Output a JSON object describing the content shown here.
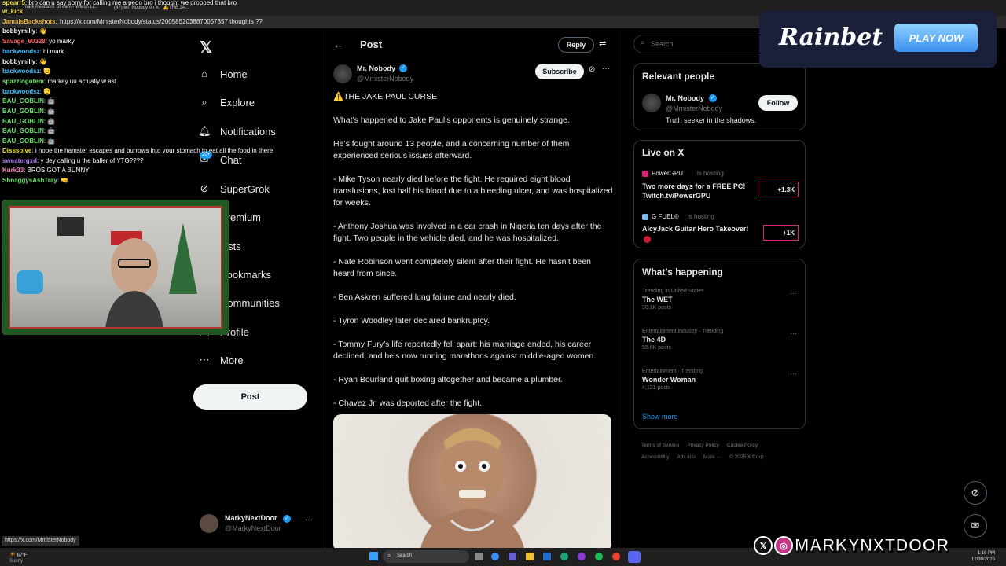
{
  "browser": {
    "tabs": [
      "markynextdoor Stream - Watch Li...",
      "(47) Mr. Nobody on X: \"⚠️THE JA...\""
    ],
    "url": "https://x.com/MmisterNobody/status/2005852038870057357 thoughts ??",
    "status_url": "https://x.com/MmisterNobody"
  },
  "chat": {
    "lines": [
      {
        "user": "spearr5",
        "color": "#f0e040",
        "msg": "bro can u say sorry for calling me a pedo bro i thought we dropped that bro"
      },
      {
        "user": "w_kick",
        "color": "#f0e040",
        "msg": ""
      },
      {
        "user": "JamalsBackshots",
        "color": "#f0c040",
        "msg": ""
      },
      {
        "user": "bobbymilly",
        "color": "#ffffff",
        "msg": "👋"
      },
      {
        "user": "Savage_60328",
        "color": "#ff6060",
        "msg": "yo marky"
      },
      {
        "user": "backwoodsz",
        "color": "#40c0ff",
        "msg": "hi mark"
      },
      {
        "user": "bobbymilly",
        "color": "#ffffff",
        "msg": "👋"
      },
      {
        "user": "backwoodsz",
        "color": "#40c0ff",
        "msg": "🫡"
      },
      {
        "user": "spazzlogotem",
        "color": "#70e070",
        "msg": "markey uu actually w asf"
      },
      {
        "user": "backwoodsz",
        "color": "#40c0ff",
        "msg": "🫡"
      },
      {
        "user": "BAU_GOBLIN",
        "color": "#70e070",
        "msg": "🤖"
      },
      {
        "user": "BAU_GOBLIN",
        "color": "#70e070",
        "msg": "🤖"
      },
      {
        "user": "BAU_GOBLIN",
        "color": "#70e070",
        "msg": "🤖"
      },
      {
        "user": "BAU_GOBLIN",
        "color": "#70e070",
        "msg": "🤖"
      },
      {
        "user": "BAU_GOBLIN",
        "color": "#70e070",
        "msg": "🤖"
      },
      {
        "user": "Disssolve",
        "color": "#f0e040",
        "msg": "i hope the hamster escapes and burrows into your stomach to eat all the food in there"
      },
      {
        "user": "sweatergxd",
        "color": "#b080ff",
        "msg": "y dey calling u the baller of YTG????"
      },
      {
        "user": "Kurk33",
        "color": "#ff80c0",
        "msg": "BROS GOT A BUNNY"
      },
      {
        "user": "ShnaggysAshTray",
        "color": "#70e070",
        "msg": "🤜"
      }
    ]
  },
  "nav": {
    "items": [
      {
        "label": "Home",
        "icon": "home-icon"
      },
      {
        "label": "Explore",
        "icon": "search-icon"
      },
      {
        "label": "Notifications",
        "icon": "bell-icon"
      },
      {
        "label": "Chat",
        "icon": "chat-icon"
      },
      {
        "label": "SuperGrok",
        "icon": "grok-icon"
      },
      {
        "label": "Premium",
        "icon": "x-icon"
      },
      {
        "label": "Lists",
        "icon": "list-icon"
      },
      {
        "label": "Bookmarks",
        "icon": "bookmark-icon"
      },
      {
        "label": "Communities",
        "icon": "people-icon"
      },
      {
        "label": "Profile",
        "icon": "person-icon"
      },
      {
        "label": "More",
        "icon": "more-icon"
      }
    ],
    "post_label": "Post",
    "account": {
      "name": "MarkyNextDoor",
      "handle": "@MarkyNextDoor"
    }
  },
  "post": {
    "header_title": "Post",
    "reply_label": "Reply",
    "author_name": "Mr. Nobody",
    "author_handle": "@MmisterNobody",
    "subscribe_label": "Subscribe",
    "title": "⚠️THE JAKE PAUL CURSE",
    "paragraphs": [
      "What’s happened to Jake Paul’s opponents is genuinely strange.",
      "He’s fought around 13 people, and a concerning number of them experienced serious issues afterward.",
      "- Mike Tyson nearly died before the fight. He required eight blood transfusions, lost half his blood due to a bleeding ulcer, and was hospitalized for weeks.",
      "- Anthony Joshua was involved in a car crash in Nigeria ten days after the fight. Two people in the vehicle died, and he was hospitalized.",
      "- Nate Robinson went completely silent after their fight. He hasn’t been heard from since.",
      "- Ben Askren suffered lung failure and nearly died.",
      "- Tyron Woodley later declared bankruptcy.",
      "- Tommy Fury’s life reportedly fell apart: his marriage ended, his career declined, and he’s now running marathons against middle-aged women.",
      "- Ryan Bourland quit boxing altogether and became a plumber.",
      "- Chavez Jr. was deported after the fight."
    ]
  },
  "right": {
    "search_placeholder": "Search",
    "relevant": {
      "title": "Relevant people",
      "name": "Mr. Nobody",
      "handle": "@MmisterNobody",
      "follow_label": "Follow",
      "bio": "Truth seeker in the shadows."
    },
    "live": {
      "title": "Live on X",
      "items": [
        {
          "host": "PowerGPU",
          "status": "is hosting",
          "title": "Two more days for a FREE PC! Twitch.tv/PowerGPU",
          "count": "+1.3K"
        },
        {
          "host": "G FUEL®",
          "status": "is hosting",
          "title": "AlcyJack Guitar Hero Takeover!",
          "count": "+1K"
        }
      ]
    },
    "happening": {
      "title": "What’s happening",
      "topics": [
        {
          "context": "Trending in United States",
          "name": "The WET",
          "posts": "30.1K posts"
        },
        {
          "context": "Entertainment industry · Trending",
          "name": "The 4D",
          "posts": "55.6K posts"
        },
        {
          "context": "Entertainment · Trending",
          "name": "Wonder Woman",
          "posts": "4,121 posts"
        }
      ],
      "show_more": "Show more"
    },
    "footer": [
      "Terms of Service",
      "Privacy Policy",
      "Cookie Policy",
      "Accessibility",
      "Ads info",
      "More ···",
      "© 2025 X Corp."
    ]
  },
  "overlay": {
    "rainbet_logo": "Rainbet",
    "rainbet_cta": "PLAY NOW",
    "handle": "MARKYNXTDOOR",
    "notification_badge": "20+"
  },
  "taskbar": {
    "weather_temp": "67°F",
    "weather_cond": "Sunny",
    "search_placeholder": "Search",
    "time": "1:16 PM",
    "date": "12/30/2025"
  }
}
